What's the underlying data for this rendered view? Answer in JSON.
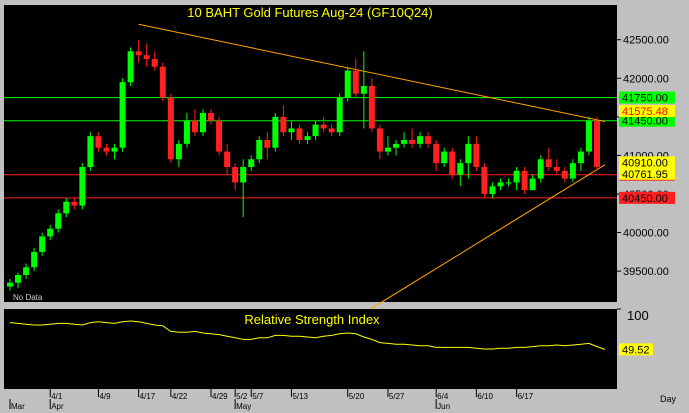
{
  "chart_data": [
    {
      "type": "candlestick",
      "title": "10 BAHT Gold Futures Aug-24 (GF10Q24)",
      "ylim": [
        39100,
        42950
      ],
      "y_ticks": [
        "42500.00",
        "42000.00",
        "41500.00",
        "41000.00",
        "40500.00",
        "40000.00",
        "39500.00"
      ],
      "y_tick_values": [
        42500,
        42000,
        41500,
        41000,
        40500,
        40000,
        39500
      ],
      "watermark": "No Data",
      "x_labels": [
        "4/1",
        "4/9",
        "4/17",
        "4/22",
        "4/29",
        "5/2",
        "5/7",
        "5/13",
        "5/20",
        "5/27",
        "6/4",
        "6/10",
        "6/17"
      ],
      "x_label_index": [
        5,
        11,
        16,
        20,
        25,
        28,
        30,
        35,
        42,
        47,
        53,
        58,
        63
      ],
      "month_labels": [
        "Mar",
        "Apr",
        "May",
        "Jun"
      ],
      "month_label_index": [
        0,
        5,
        28,
        53
      ],
      "candles": [
        [
          39300,
          39400,
          39250,
          39350
        ],
        [
          39350,
          39480,
          39280,
          39450
        ],
        [
          39450,
          39600,
          39400,
          39550
        ],
        [
          39550,
          39800,
          39500,
          39750
        ],
        [
          39750,
          40000,
          39700,
          39950
        ],
        [
          39950,
          40100,
          39900,
          40050
        ],
        [
          40050,
          40300,
          40000,
          40250
        ],
        [
          40250,
          40450,
          40200,
          40400
        ],
        [
          40400,
          40450,
          40300,
          40350
        ],
        [
          40350,
          40900,
          40300,
          40850
        ],
        [
          40850,
          41300,
          40800,
          41250
        ],
        [
          41250,
          41300,
          41050,
          41100
        ],
        [
          41100,
          41150,
          41000,
          41050
        ],
        [
          41050,
          41150,
          40950,
          41100
        ],
        [
          41100,
          42000,
          41050,
          41950
        ],
        [
          41950,
          42400,
          41900,
          42350
        ],
        [
          42350,
          42500,
          42200,
          42300
        ],
        [
          42300,
          42450,
          42150,
          42250
        ],
        [
          42250,
          42350,
          42100,
          42150
        ],
        [
          42150,
          42200,
          41700,
          41750
        ],
        [
          41750,
          41800,
          40900,
          40950
        ],
        [
          40950,
          41200,
          40850,
          41150
        ],
        [
          41150,
          41550,
          41100,
          41450
        ],
        [
          41450,
          41600,
          41250,
          41300
        ],
        [
          41300,
          41600,
          41250,
          41550
        ],
        [
          41550,
          41600,
          41400,
          41450
        ],
        [
          41450,
          41500,
          41000,
          41050
        ],
        [
          41050,
          41150,
          40750,
          40850
        ],
        [
          40850,
          40900,
          40550,
          40650
        ],
        [
          40650,
          40950,
          40200,
          40850
        ],
        [
          40850,
          41000,
          40800,
          40950
        ],
        [
          40950,
          41250,
          40900,
          41200
        ],
        [
          41200,
          41300,
          40950,
          41100
        ],
        [
          41100,
          41550,
          41050,
          41500
        ],
        [
          41500,
          41650,
          41250,
          41300
        ],
        [
          41300,
          41450,
          41200,
          41350
        ],
        [
          41350,
          41400,
          41150,
          41200
        ],
        [
          41200,
          41300,
          41150,
          41250
        ],
        [
          41250,
          41450,
          41200,
          41400
        ],
        [
          41400,
          41500,
          41300,
          41350
        ],
        [
          41350,
          41400,
          41250,
          41300
        ],
        [
          41300,
          41800,
          41250,
          41750
        ],
        [
          41750,
          42150,
          41700,
          42100
        ],
        [
          42100,
          42250,
          41750,
          41800
        ],
        [
          41800,
          42350,
          41350,
          41900
        ],
        [
          41900,
          42000,
          41300,
          41350
        ],
        [
          41350,
          41400,
          40950,
          41050
        ],
        [
          41050,
          41250,
          41000,
          41100
        ],
        [
          41100,
          41200,
          41000,
          41150
        ],
        [
          41150,
          41300,
          41100,
          41200
        ],
        [
          41200,
          41350,
          41100,
          41150
        ],
        [
          41150,
          41300,
          41100,
          41250
        ],
        [
          41250,
          41300,
          41100,
          41150
        ],
        [
          41150,
          41200,
          40800,
          40900
        ],
        [
          40900,
          41100,
          40850,
          41050
        ],
        [
          41050,
          41100,
          40700,
          40750
        ],
        [
          40750,
          40950,
          40600,
          40900
        ],
        [
          40900,
          41250,
          40700,
          41150
        ],
        [
          41150,
          41250,
          40800,
          40850
        ],
        [
          40850,
          40900,
          40450,
          40500
        ],
        [
          40500,
          40650,
          40450,
          40600
        ],
        [
          40600,
          40700,
          40550,
          40650
        ],
        [
          40650,
          40700,
          40600,
          40650
        ],
        [
          40650,
          40850,
          40550,
          40800
        ],
        [
          40800,
          40850,
          40500,
          40550
        ],
        [
          40550,
          40750,
          40550,
          40700
        ],
        [
          40700,
          41000,
          40650,
          40950
        ],
        [
          40950,
          41100,
          40800,
          40850
        ],
        [
          40850,
          40950,
          40750,
          40800
        ],
        [
          40800,
          40850,
          40650,
          40700
        ],
        [
          40700,
          40950,
          40650,
          40900
        ],
        [
          40900,
          41100,
          40800,
          41050
        ],
        [
          41050,
          41500,
          41000,
          41450
        ],
        [
          41450,
          41500,
          40800,
          40850
        ]
      ],
      "horizontal_lines": [
        {
          "value": 41750,
          "label": "41750.00",
          "color": "#00ff00"
        },
        {
          "value": 41450,
          "label": "41450.00",
          "color": "#00ff00"
        },
        {
          "value": 40750,
          "label": "40750.00",
          "color": "#ff2020"
        },
        {
          "value": 40450,
          "label": "40450.00",
          "color": "#ff2020"
        }
      ],
      "trendlines": [
        {
          "from": [
            16,
            42700
          ],
          "to": [
            74,
            41440
          ],
          "color": "#ffa500"
        },
        {
          "from": [
            40,
            38700
          ],
          "to": [
            74,
            40880
          ],
          "color": "#ffa500"
        }
      ],
      "price_labels": [
        {
          "value": 41575.48,
          "label": "41575.48",
          "bg": "#ffff00",
          "fg": "#ff0000"
        },
        {
          "value": 40910.0,
          "label": "40910.00",
          "bg": "#ffff00",
          "fg": "#000000"
        },
        {
          "value": 40761.95,
          "label": "40761.95",
          "bg": "#ffff00",
          "fg": "#000000"
        }
      ]
    },
    {
      "type": "line",
      "title": "Relative Strength Index",
      "ylim": [
        0,
        100
      ],
      "y_ticks": [
        "100"
      ],
      "y_tick_values": [
        100
      ],
      "last_value_label": "49.52",
      "x_axis_label": "Day",
      "values": [
        83,
        82,
        81,
        80,
        80,
        81,
        82,
        82,
        81,
        80,
        83,
        84,
        83,
        82,
        84,
        85,
        84,
        82,
        80,
        79,
        72,
        71,
        71,
        72,
        70,
        69,
        68,
        66,
        64,
        62,
        62,
        64,
        64,
        67,
        67,
        66,
        66,
        65,
        64,
        66,
        67,
        69,
        70,
        69,
        65,
        62,
        58,
        57,
        56,
        56,
        55,
        54,
        54,
        52,
        52,
        52,
        52,
        52,
        51,
        50,
        50,
        51,
        51,
        52,
        52,
        53,
        54,
        54,
        55,
        54,
        55,
        56,
        57,
        53,
        49.52
      ]
    }
  ],
  "colors": {
    "background": "#000000",
    "frame": "#c0c0c0",
    "up_candle": "#00ff00",
    "down_candle": "#ff2020",
    "axis_text": "#000000",
    "title": "#ffff00",
    "rsi_line": "#ffff00"
  }
}
